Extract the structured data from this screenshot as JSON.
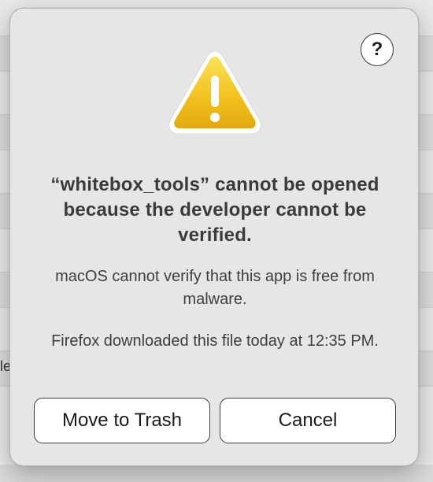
{
  "background": {
    "partial_text": "le"
  },
  "dialog": {
    "help_label": "?",
    "icon": "warning-triangle-icon",
    "title": "“whitebox_tools” cannot be opened because the developer cannot be verified.",
    "message_1": "macOS cannot verify that this app is free from malware.",
    "message_2": "Firefox downloaded this file today at 12:35 PM.",
    "buttons": {
      "move_to_trash": "Move to Trash",
      "cancel": "Cancel"
    }
  },
  "colors": {
    "warning_yellow": "#f5c518",
    "dialog_background": "#e6e6e6"
  }
}
